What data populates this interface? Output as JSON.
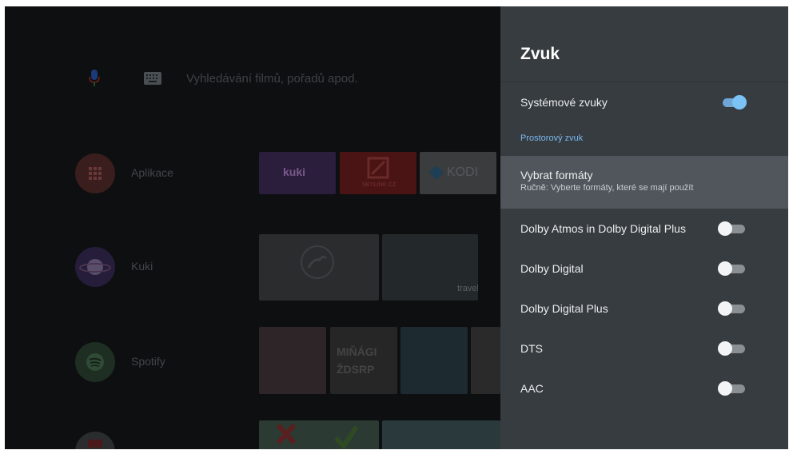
{
  "home": {
    "search_placeholder": "Vyhledávání filmů, pořadů apod.",
    "icons": [
      "mic-icon",
      "keyboard-icon"
    ],
    "apps": [
      {
        "label": "Aplikace",
        "icon": "apps-grid-icon",
        "color": "#3a1e1e"
      },
      {
        "label": "Kuki",
        "icon": "kuki-planet-icon",
        "color": "#261d3a"
      },
      {
        "label": "Spotify",
        "icon": "spotify-icon",
        "color": "#1e2e22"
      }
    ],
    "tiles_row1": [
      "kuki",
      "SKYLINK CZ",
      "KODI"
    ],
    "tiles_row2_badge": "travel",
    "tiles_row3_text": "MIŇÁGI ŽDSRP"
  },
  "panel": {
    "title": "Zvuk",
    "system_sounds": {
      "label": "Systémové zvuky",
      "on": true
    },
    "section": "Prostorový zvuk",
    "select_formats": {
      "label": "Vybrat formáty",
      "sub": "Ručně: Vyberte formáty, které se mají použít"
    },
    "formats": [
      {
        "label": "Dolby Atmos in Dolby Digital Plus",
        "on": false
      },
      {
        "label": "Dolby Digital",
        "on": false
      },
      {
        "label": "Dolby Digital Plus",
        "on": false
      },
      {
        "label": "DTS",
        "on": false
      },
      {
        "label": "AAC",
        "on": false
      }
    ]
  },
  "colors": {
    "accent": "#7cc3f5",
    "section": "#79b8f0",
    "panel": "#373c40",
    "selected": "#50565b"
  }
}
